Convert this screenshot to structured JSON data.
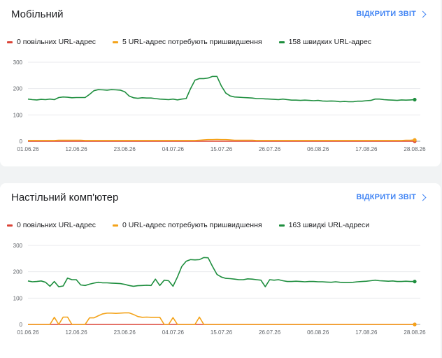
{
  "colors": {
    "slow": "#db4437",
    "improve": "#f4a31a",
    "fast": "#1e8e3e",
    "link": "#4285f4"
  },
  "sections": [
    {
      "title": "Мобільний",
      "link_label": "ВІДКРИТИ ЗВІТ",
      "legend": [
        {
          "label": "0 повільних URL-адрес",
          "color": "#db4437"
        },
        {
          "label": "5 URL-адрес потребують пришвидшення",
          "color": "#f4a31a"
        },
        {
          "label": "158 швидких URL-адрес",
          "color": "#1e8e3e"
        }
      ]
    },
    {
      "title": "Настільний комп'ютер",
      "link_label": "ВІДКРИТИ ЗВІТ",
      "legend": [
        {
          "label": "0 повільних URL-адрес",
          "color": "#db4437"
        },
        {
          "label": "0 URL-адрес потребують пришвидшення",
          "color": "#f4a31a"
        },
        {
          "label": "163 швидкі URL-адреси",
          "color": "#1e8e3e"
        }
      ]
    }
  ],
  "chart_data": [
    {
      "type": "line",
      "title": "Мобільний",
      "ylim": [
        0,
        300
      ],
      "yticks": [
        "300",
        "200",
        "100",
        "0"
      ],
      "xtick_labels": [
        "01.06.26",
        "12.06.26",
        "23.06.26",
        "04.07.26",
        "15.07.26",
        "26.07.26",
        "06.08.26",
        "17.08.26",
        "28.08.26"
      ],
      "series": [
        {
          "name": "0 повільних URL-адрес",
          "color": "#db4437",
          "values": [
            0,
            0,
            0,
            0,
            0,
            0,
            0,
            0,
            0,
            0,
            0,
            0,
            0,
            0,
            0,
            0,
            0,
            0,
            0,
            0,
            0,
            0,
            0,
            0,
            0,
            0,
            0,
            0,
            0,
            0,
            0,
            0,
            0,
            0,
            0,
            0,
            0,
            0,
            0,
            0,
            0,
            0,
            0,
            0,
            0,
            0,
            0,
            0,
            0,
            0,
            0,
            0,
            0,
            0,
            0,
            0,
            0,
            0,
            0,
            0,
            0,
            0,
            0,
            0,
            0,
            0,
            0,
            0,
            0,
            0,
            0,
            0,
            0,
            0,
            0,
            0,
            0,
            0,
            0,
            0,
            0,
            0,
            0,
            0,
            0,
            0,
            0,
            0,
            0
          ]
        },
        {
          "name": "5 URL-адрес потребують пришвидшення",
          "color": "#f4a31a",
          "values": [
            3,
            3,
            3,
            3,
            3,
            3,
            3,
            4,
            4,
            4,
            4,
            4,
            4,
            3,
            3,
            3,
            3,
            3,
            3,
            3,
            3,
            3,
            3,
            3,
            3,
            3,
            3,
            3,
            3,
            3,
            3,
            3,
            3,
            3,
            3,
            3,
            3,
            3,
            3,
            4,
            5,
            6,
            6,
            7,
            6,
            6,
            5,
            4,
            4,
            4,
            4,
            4,
            3,
            3,
            3,
            3,
            3,
            3,
            3,
            3,
            3,
            3,
            3,
            3,
            3,
            3,
            3,
            3,
            3,
            3,
            3,
            3,
            3,
            3,
            3,
            3,
            3,
            3,
            3,
            3,
            3,
            3,
            3,
            3,
            3,
            3,
            4,
            4,
            5
          ]
        },
        {
          "name": "158 швидких URL-адрес",
          "color": "#1e8e3e",
          "values": [
            160,
            158,
            157,
            159,
            158,
            160,
            158,
            166,
            168,
            167,
            165,
            166,
            166,
            166,
            178,
            192,
            196,
            195,
            194,
            196,
            195,
            194,
            188,
            172,
            165,
            163,
            165,
            164,
            164,
            162,
            160,
            159,
            158,
            160,
            157,
            160,
            162,
            200,
            232,
            238,
            238,
            240,
            246,
            246,
            210,
            183,
            172,
            168,
            167,
            166,
            165,
            164,
            162,
            162,
            161,
            160,
            159,
            158,
            160,
            158,
            156,
            156,
            155,
            156,
            155,
            154,
            155,
            153,
            152,
            153,
            152,
            150,
            151,
            150,
            150,
            152,
            152,
            154,
            155,
            160,
            160,
            158,
            157,
            156,
            155,
            157,
            156,
            157,
            158
          ]
        }
      ]
    },
    {
      "type": "line",
      "title": "Настільний комп'ютер",
      "ylim": [
        0,
        300
      ],
      "yticks": [
        "300",
        "200",
        "100",
        "0"
      ],
      "xtick_labels": [
        "01.06.26",
        "12.06.26",
        "23.06.26",
        "04.07.26",
        "15.07.26",
        "26.07.26",
        "06.08.26",
        "17.08.26",
        "28.08.26"
      ],
      "series": [
        {
          "name": "0 повільних URL-адрес",
          "color": "#db4437",
          "values": [
            0,
            0,
            0,
            0,
            0,
            0,
            0,
            0,
            0,
            0,
            0,
            0,
            0,
            0,
            0,
            0,
            0,
            0,
            0,
            0,
            0,
            0,
            0,
            0,
            0,
            0,
            0,
            0,
            0,
            0,
            0,
            0,
            0,
            0,
            0,
            0,
            0,
            0,
            0,
            0,
            0,
            0,
            0,
            0,
            0,
            0,
            0,
            0,
            0,
            0,
            0,
            0,
            0,
            0,
            0,
            0,
            0,
            0,
            0,
            0,
            0,
            0,
            0,
            0,
            0,
            0,
            0,
            0,
            0,
            0,
            0,
            0,
            0,
            0,
            0,
            0,
            0,
            0,
            0,
            0,
            0,
            0,
            0,
            0,
            0,
            0,
            0,
            0,
            0
          ]
        },
        {
          "name": "0 URL-адрес потребують пришвидшення",
          "color": "#f4a31a",
          "values": [
            0,
            0,
            0,
            0,
            0,
            0,
            27,
            0,
            28,
            28,
            0,
            0,
            0,
            0,
            25,
            25,
            33,
            40,
            43,
            43,
            42,
            43,
            44,
            44,
            38,
            30,
            27,
            28,
            27,
            27,
            27,
            0,
            0,
            26,
            0,
            0,
            0,
            0,
            0,
            28,
            0,
            0,
            0,
            0,
            0,
            0,
            0,
            0,
            0,
            0,
            0,
            0,
            0,
            0,
            0,
            0,
            0,
            0,
            0,
            0,
            0,
            0,
            0,
            0,
            0,
            0,
            0,
            0,
            0,
            0,
            0,
            0,
            0,
            0,
            0,
            0,
            0,
            0,
            0,
            0,
            0,
            0,
            0,
            0,
            0,
            0,
            0,
            0,
            0
          ]
        },
        {
          "name": "163 швидкі URL-адреси",
          "color": "#1e8e3e",
          "values": [
            165,
            162,
            163,
            165,
            160,
            145,
            163,
            143,
            146,
            176,
            170,
            170,
            150,
            148,
            153,
            157,
            160,
            158,
            158,
            157,
            156,
            155,
            152,
            148,
            145,
            147,
            148,
            149,
            148,
            172,
            148,
            168,
            166,
            145,
            180,
            220,
            240,
            246,
            245,
            246,
            254,
            253,
            220,
            190,
            180,
            175,
            174,
            172,
            170,
            170,
            173,
            172,
            170,
            168,
            143,
            170,
            168,
            170,
            166,
            163,
            163,
            164,
            163,
            162,
            163,
            163,
            162,
            162,
            161,
            160,
            162,
            160,
            159,
            159,
            160,
            162,
            163,
            164,
            166,
            168,
            166,
            165,
            164,
            165,
            163,
            163,
            164,
            163,
            163
          ]
        }
      ]
    }
  ]
}
